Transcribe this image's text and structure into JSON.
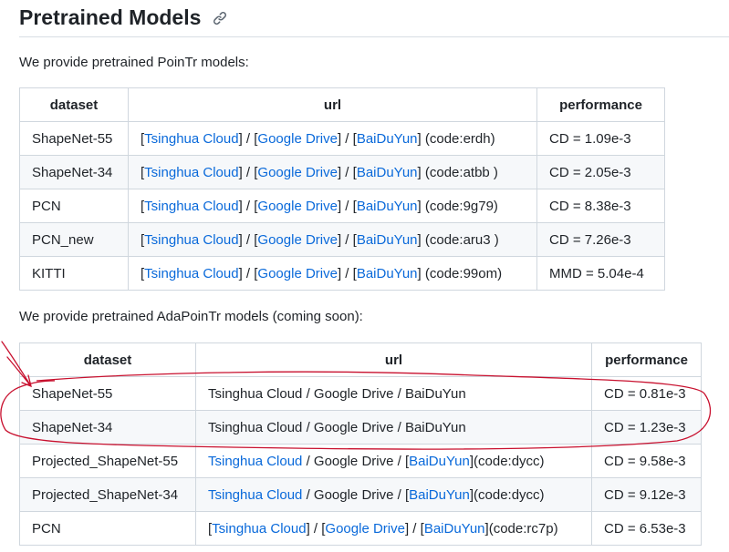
{
  "title": "Pretrained Models",
  "intro1": "We provide pretrained PoinTr models:",
  "intro2": "We provide pretrained AdaPoinTr models (coming soon):",
  "headers": {
    "dataset": "dataset",
    "url": "url",
    "performance": "performance"
  },
  "table1": [
    {
      "dataset": "ShapeNet-55",
      "tsinghua": "Tsinghua Cloud",
      "google": "Google Drive",
      "baidu": "BaiDuYun",
      "code": "(code:erdh)",
      "performance": "CD = 1.09e-3"
    },
    {
      "dataset": "ShapeNet-34",
      "tsinghua": "Tsinghua Cloud",
      "google": "Google Drive",
      "baidu": "BaiDuYun",
      "code": "(code:atbb )",
      "performance": "CD = 2.05e-3"
    },
    {
      "dataset": "PCN",
      "tsinghua": "Tsinghua Cloud",
      "google": "Google Drive",
      "baidu": "BaiDuYun",
      "code": "(code:9g79)",
      "performance": "CD = 8.38e-3"
    },
    {
      "dataset": "PCN_new",
      "tsinghua": "Tsinghua Cloud",
      "google": "Google Drive",
      "baidu": "BaiDuYun",
      "code": "(code:aru3 )",
      "performance": "CD = 7.26e-3"
    },
    {
      "dataset": "KITTI",
      "tsinghua": "Tsinghua Cloud",
      "google": "Google Drive",
      "baidu": "BaiDuYun",
      "code": "(code:99om)",
      "performance": "MMD = 5.04e-4"
    }
  ],
  "table2": [
    {
      "dataset": "ShapeNet-55",
      "url_text": "Tsinghua Cloud / Google Drive / BaiDuYun",
      "performance": "CD = 0.81e-3"
    },
    {
      "dataset": "ShapeNet-34",
      "url_text": "Tsinghua Cloud / Google Drive / BaiDuYun",
      "performance": "CD = 1.23e-3"
    },
    {
      "dataset": "Projected_ShapeNet-55",
      "tsinghua": "Tsinghua Cloud",
      "mid": " / Google Drive / [",
      "baidu": "BaiDuYun",
      "code": "](code:dycc)",
      "performance": "CD = 9.58e-3"
    },
    {
      "dataset": "Projected_ShapeNet-34",
      "tsinghua": "Tsinghua Cloud",
      "mid": " / Google Drive / [",
      "baidu": "BaiDuYun",
      "code": "](code:dycc)",
      "performance": "CD = 9.12e-3"
    },
    {
      "dataset": "PCN",
      "tsinghua": "Tsinghua Cloud",
      "google": "Google Drive",
      "baidu": "BaiDuYun",
      "code": "(code:rc7p)",
      "performance": "CD = 6.53e-3"
    }
  ],
  "colors": {
    "link": "#0969da",
    "annotation": "#c8102e",
    "border": "#d0d7de",
    "stripe": "#f6f8fa"
  }
}
